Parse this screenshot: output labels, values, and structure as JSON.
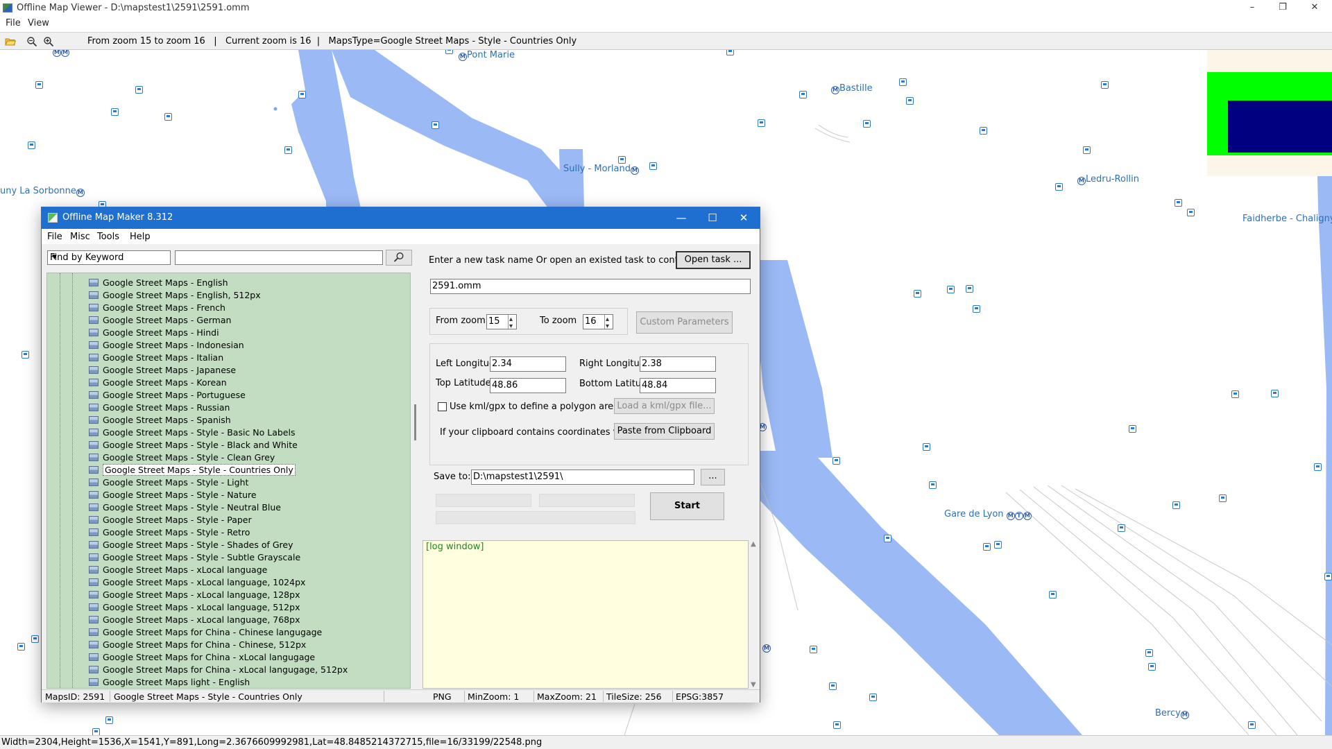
{
  "viewer": {
    "title": "Offline Map Viewer - D:\\mapstest1\\2591\\2591.omm",
    "menu": [
      "File",
      "View"
    ],
    "toolbar_status": "From zoom 15 to zoom 16   |   Current zoom is 16  |   MapsType=Google Street Maps - Style - Countries Only",
    "window_controls": [
      "–",
      "❐",
      "✕"
    ],
    "status_bar": "Width=2304,Height=1536,X=1541,Y=891,Long=2.3676609992981,Lat=48.8485214372715,file=16/33199/22548.png"
  },
  "map": {
    "labels": [
      "Pont Marie",
      "Bastille",
      "Sully - Morland",
      "uny La Sorbonne",
      "Ledru-Rollin",
      "Faidherbe - Chaligny",
      "Gare de Lyon",
      "Bercy"
    ],
    "colors": {
      "water": "#9ab9f5",
      "bus": "#2a79d4",
      "metro": "#2f5ea8",
      "overlay_green": "#00ff00",
      "overlay_navy": "#000080"
    }
  },
  "dialog": {
    "title": "Offline Map Maker 8.312",
    "menu": [
      "File",
      "Misc",
      "Tools",
      "Help"
    ],
    "window_controls": [
      "—",
      "☐",
      "✕"
    ],
    "search": {
      "mode": "Find by Keyword",
      "value": ""
    },
    "tree_items": [
      "Google Street Maps - English",
      "Google Street Maps - English, 512px",
      "Google Street Maps - French",
      "Google Street Maps - German",
      "Google Street Maps - Hindi",
      "Google Street Maps - Indonesian",
      "Google Street Maps - Italian",
      "Google Street Maps - Japanese",
      "Google Street Maps - Korean",
      "Google Street Maps - Portuguese",
      "Google Street Maps - Russian",
      "Google Street Maps - Spanish",
      "Google Street Maps - Style - Basic No Labels",
      "Google Street Maps - Style - Black and White",
      "Google Street Maps - Style - Clean Grey",
      "Google Street Maps - Style - Countries Only",
      "Google Street Maps - Style - Light",
      "Google Street Maps - Style - Nature",
      "Google Street Maps - Style - Neutral Blue",
      "Google Street Maps - Style - Paper",
      "Google Street Maps - Style - Retro",
      "Google Street Maps - Style - Shades of Grey",
      "Google Street Maps - Style - Subtle Grayscale",
      "Google Street Maps - xLocal language",
      "Google Street Maps - xLocal language, 1024px",
      "Google Street Maps - xLocal language, 128px",
      "Google Street Maps - xLocal language, 512px",
      "Google Street Maps - xLocal language, 768px",
      "Google Street Maps for China - Chinese langugage",
      "Google Street Maps for China - Chinese, 512px",
      "Google Street Maps for China - xLocal langugage",
      "Google Street Maps for China - xLocal langugage, 512px",
      "Google Street Maps light - English"
    ],
    "selected_index": 15,
    "task_prompt": "Enter a new task name Or open an existed task to continue:",
    "open_task_label": "Open task ...",
    "task_name": "2591.omm",
    "from_zoom_label": "From zoom",
    "from_zoom": "15",
    "to_zoom_label": "To zoom",
    "to_zoom": "16",
    "custom_params_label": "Custom Parameters",
    "left_lon_label": "Left Longitude",
    "left_lon": "2.34",
    "right_lon_label": "Right Longitude",
    "right_lon": "2.38",
    "top_lat_label": "Top Latitude",
    "top_lat": "48.86",
    "bottom_lat_label": "Bottom Latitude",
    "bottom_lat": "48.84",
    "kml_checkbox_label": "Use kml/gpx to define a polygon area",
    "load_kml_label": "Load a kml/gpx file...",
    "clipboard_text": "If your clipboard contains coordinates values:",
    "paste_label": "Paste from Clipboard",
    "save_to_label": "Save to:",
    "save_to": "D:\\mapstest1\\2591\\",
    "browse_label": "...",
    "start_label": "Start",
    "log_text": "[log window]",
    "status": {
      "maps_id": "MapsID: 2591",
      "maps_name": "Google Street Maps - Style - Countries Only",
      "format": "PNG",
      "min_zoom": "MinZoom: 1",
      "max_zoom": "MaxZoom: 21",
      "tile_size": "TileSize: 256",
      "epsg": "EPSG:3857"
    }
  }
}
